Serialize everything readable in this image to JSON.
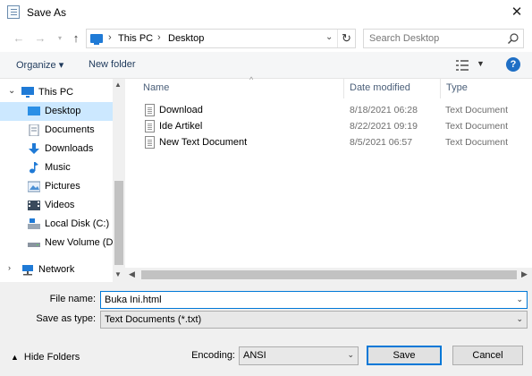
{
  "window": {
    "title": "Save As",
    "close_label": "✕"
  },
  "nav": {
    "back_icon": "back-arrow-icon",
    "forward_icon": "forward-arrow-icon",
    "up_icon": "up-arrow-icon",
    "breadcrumb": [
      "This PC",
      "Desktop"
    ],
    "search_placeholder": "Search Desktop"
  },
  "toolbar": {
    "organize_label": "Organize ▾",
    "new_folder_label": "New folder",
    "help_label": "?"
  },
  "sidebar": {
    "items": [
      {
        "label": "This PC",
        "icon": "computer-icon"
      },
      {
        "label": "Desktop",
        "icon": "desktop-icon",
        "selected": true
      },
      {
        "label": "Documents",
        "icon": "documents-icon"
      },
      {
        "label": "Downloads",
        "icon": "downloads-icon"
      },
      {
        "label": "Music",
        "icon": "music-icon"
      },
      {
        "label": "Pictures",
        "icon": "pictures-icon"
      },
      {
        "label": "Videos",
        "icon": "videos-icon"
      },
      {
        "label": "Local Disk (C:)",
        "icon": "local-disk-icon"
      },
      {
        "label": "New Volume (D:",
        "icon": "drive-icon"
      },
      {
        "label": "Network",
        "icon": "network-icon"
      }
    ]
  },
  "files": {
    "columns": [
      "Name",
      "Date modified",
      "Type"
    ],
    "rows": [
      {
        "name": "Download",
        "date": "8/18/2021 06:28",
        "type": "Text Document"
      },
      {
        "name": "Ide Artikel",
        "date": "8/22/2021 09:19",
        "type": "Text Document"
      },
      {
        "name": "New Text Document",
        "date": "8/5/2021 06:57",
        "type": "Text Document"
      }
    ]
  },
  "form": {
    "file_name_label": "File name:",
    "file_name_value": "Buka Ini.html",
    "save_type_label": "Save as type:",
    "save_type_value": "Text Documents (*.txt)",
    "encoding_label": "Encoding:",
    "encoding_value": "ANSI",
    "save_label": "Save",
    "cancel_label": "Cancel",
    "hide_folders_label": "Hide Folders"
  },
  "colors": {
    "accent": "#0078d7",
    "selected_bg": "#cce8ff",
    "help_blue": "#1f6fc5"
  }
}
